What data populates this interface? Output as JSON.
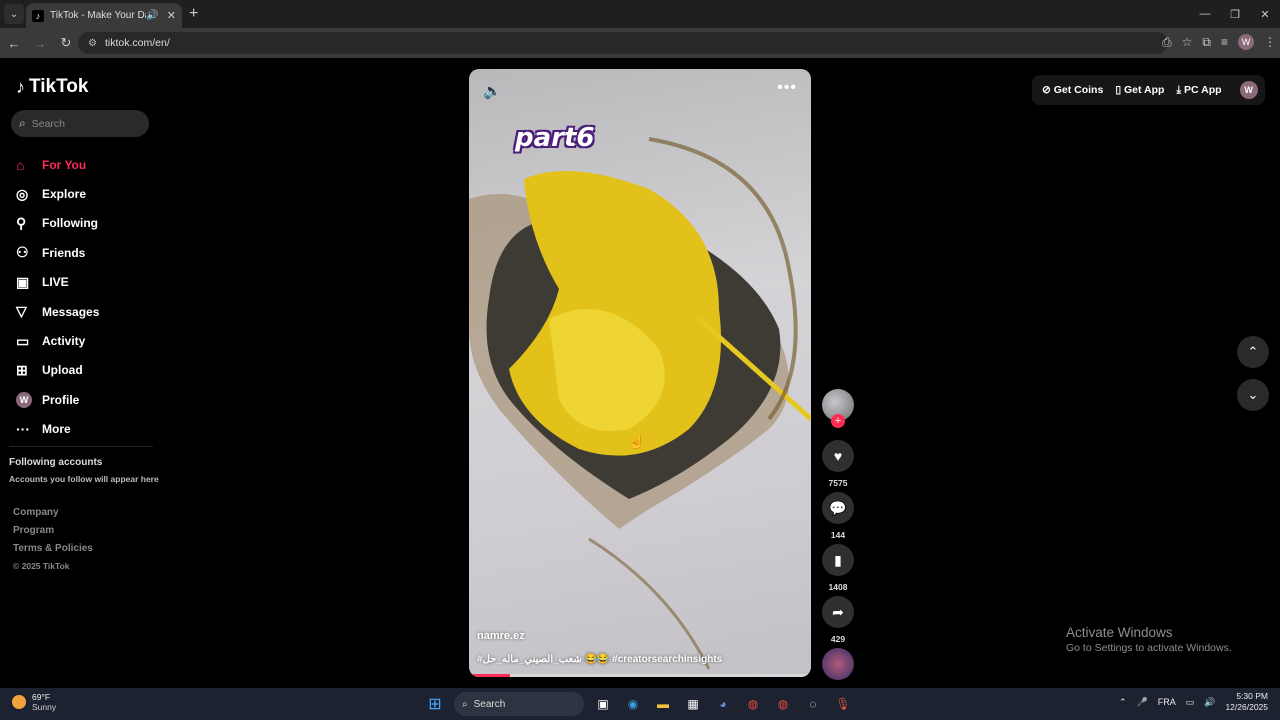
{
  "browser": {
    "tab_title": "TikTok - Make Your Day",
    "url": "tiktok.com/en/"
  },
  "sidebar": {
    "logo_text": "TikTok",
    "search_placeholder": "Search",
    "nav_items": [
      {
        "label": "For You",
        "icon": "home-icon",
        "active": true
      },
      {
        "label": "Explore",
        "icon": "compass-icon"
      },
      {
        "label": "Following",
        "icon": "following-icon"
      },
      {
        "label": "Friends",
        "icon": "friends-icon"
      },
      {
        "label": "LIVE",
        "icon": "live-icon"
      },
      {
        "label": "Messages",
        "icon": "messages-icon"
      },
      {
        "label": "Activity",
        "icon": "activity-icon"
      },
      {
        "label": "Upload",
        "icon": "upload-icon"
      },
      {
        "label": "Profile",
        "icon": "avatar",
        "avatar_letter": "W"
      },
      {
        "label": "More",
        "icon": "more-icon"
      }
    ],
    "following_accounts_title": "Following accounts",
    "following_accounts_sub": "Accounts you follow will appear here",
    "footer_links": [
      "Company",
      "Program",
      "Terms & Policies"
    ],
    "copyright": "© 2025 TikTok"
  },
  "video": {
    "overlay_text": "part6",
    "author": "namre.ez",
    "caption": "#شعب_الصيني_ماله_حل 😂😂 #creatorsearchinsights",
    "progress": 0.12
  },
  "actions": {
    "likes": "7575",
    "comments": "144",
    "saves": "1408",
    "shares": "429"
  },
  "topright": {
    "get_coins": "Get Coins",
    "get_app": "Get App",
    "pc_app": "PC App",
    "profile_letter": "W"
  },
  "activate_windows": {
    "line1": "Activate Windows",
    "line2": "Go to Settings to activate Windows."
  },
  "taskbar": {
    "temperature": "69°F",
    "condition": "Sunny",
    "search_placeholder": "Search",
    "language": "FRA",
    "time": "5:30 PM",
    "date": "12/26/2025"
  },
  "colors": {
    "accent": "#fe2c55",
    "background": "#000000"
  }
}
